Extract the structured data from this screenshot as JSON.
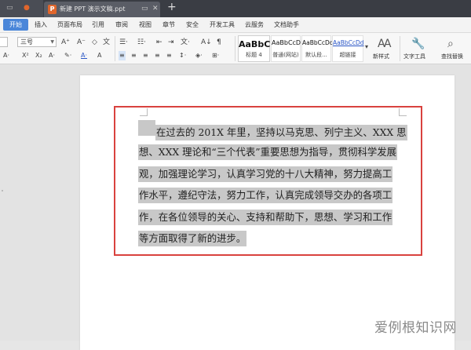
{
  "tabbar": {
    "doc_tab_title": "新建 PPT 演示文稿.ppt",
    "ppt_badge": "P",
    "add_tab": "+"
  },
  "menu": {
    "items": [
      "开始",
      "插入",
      "页面布局",
      "引用",
      "审阅",
      "视图",
      "章节",
      "安全",
      "开发工具",
      "云服务",
      "文档助手"
    ]
  },
  "ribbon": {
    "font_size": "三号",
    "styles": [
      {
        "sample": "AaBbC",
        "caption": "标题 4"
      },
      {
        "sample": "AaBbCcD",
        "caption": "普通(网站)"
      },
      {
        "sample": "AaBbCcDd",
        "caption": "默认段..."
      },
      {
        "sample": "AaBbCcDd",
        "caption": "超链接"
      }
    ],
    "new_style": "新样式",
    "text_tools": "文字工具",
    "find_replace": "查找替换"
  },
  "document": {
    "lines": [
      "在过去的 201X 年里，坚持以马克思、列宁主义、XXX 思",
      "想、XXX 理论和“三个代表”重要思想为指导，贯彻科学发展",
      "观，加强理论学习，认真学习党的十八大精神，努力提高工",
      "作水平，遵纪守法，努力工作，认真完成领导交办的各项工",
      "作，在各位领导的关心、支持和帮助下，思想、学习和工作",
      "等方面取得了新的进步。"
    ]
  },
  "watermark": "爱例根知识网",
  "colors": {
    "accent": "#4a86d9",
    "highlight": "#c8c8c8",
    "frame": "#d9423e"
  }
}
